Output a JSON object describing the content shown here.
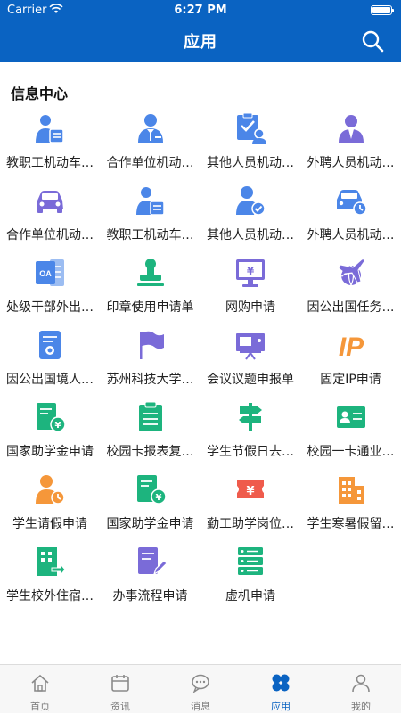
{
  "status_bar": {
    "carrier": "Carrier",
    "time": "6:27 PM"
  },
  "header": {
    "title": "应用"
  },
  "section": {
    "title": "信息中心"
  },
  "apps": [
    {
      "label": "教职工机动车…",
      "icon": "staff-vehicle-doc-icon"
    },
    {
      "label": "合作单位机动…",
      "icon": "partner-person-icon"
    },
    {
      "label": "其他人员机动…",
      "icon": "clipboard-person-icon"
    },
    {
      "label": "外聘人员机动…",
      "icon": "hired-person-icon"
    },
    {
      "label": "合作单位机动…",
      "icon": "car-icon"
    },
    {
      "label": "教职工机动车…",
      "icon": "staff-doc-icon"
    },
    {
      "label": "其他人员机动…",
      "icon": "verified-person-icon"
    },
    {
      "label": "外聘人员机动…",
      "icon": "car-clock-icon"
    },
    {
      "label": "处级干部外出…",
      "icon": "oa-icon"
    },
    {
      "label": "印章使用申请单",
      "icon": "stamp-icon"
    },
    {
      "label": "网购申请",
      "icon": "monitor-yen-icon"
    },
    {
      "label": "因公出国任务…",
      "icon": "plane-globe-icon"
    },
    {
      "label": "因公出国境人…",
      "icon": "passport-icon"
    },
    {
      "label": "苏州科技大学…",
      "icon": "flag-icon"
    },
    {
      "label": "会议议题申报单",
      "icon": "presentation-icon"
    },
    {
      "label": "固定IP申请",
      "icon": "ip-icon"
    },
    {
      "label": "国家助学金申请",
      "icon": "grant-doc-icon"
    },
    {
      "label": "校园卡报表复…",
      "icon": "report-clipboard-icon"
    },
    {
      "label": "学生节假日去…",
      "icon": "signpost-icon"
    },
    {
      "label": "校园一卡通业…",
      "icon": "id-card-icon"
    },
    {
      "label": "学生请假申请",
      "icon": "person-clock-icon"
    },
    {
      "label": "国家助学金申请",
      "icon": "grant-receipt-icon"
    },
    {
      "label": "勤工助学岗位…",
      "icon": "yen-ticket-icon"
    },
    {
      "label": "学生寒暑假留…",
      "icon": "building-icon"
    },
    {
      "label": "学生校外住宿…",
      "icon": "building-arrow-icon"
    },
    {
      "label": "办事流程申请",
      "icon": "edit-doc-icon"
    },
    {
      "label": "虚机申请",
      "icon": "server-icon"
    }
  ],
  "tabs": [
    {
      "label": "首页",
      "icon": "home-icon",
      "active": false
    },
    {
      "label": "资讯",
      "icon": "calendar-icon",
      "active": false
    },
    {
      "label": "消息",
      "icon": "chat-icon",
      "active": false
    },
    {
      "label": "应用",
      "icon": "apps-icon",
      "active": true
    },
    {
      "label": "我的",
      "icon": "profile-icon",
      "active": false
    }
  ],
  "colors": {
    "header_bg": "#0a63c2",
    "blue": "#4b86e8",
    "purple": "#7a6bd8",
    "green": "#1db47e",
    "orange": "#f5973a",
    "red": "#ef5b4c",
    "tab_active": "#0a63c2"
  }
}
